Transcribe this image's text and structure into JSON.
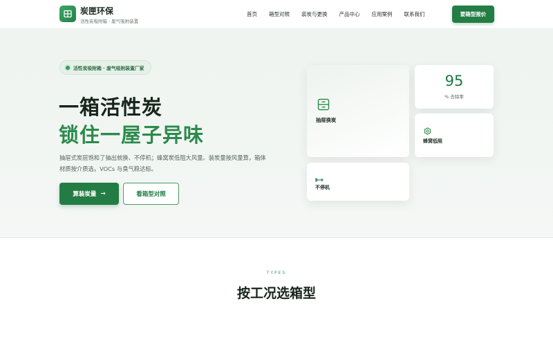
{
  "brand": {
    "name": "炭匣环保",
    "tagline": "活性炭吸附箱 · 废气吸附装置"
  },
  "nav": {
    "items": [
      {
        "label": "首页"
      },
      {
        "label": "箱型对照"
      },
      {
        "label": "装炭与更换"
      },
      {
        "label": "产品中心"
      },
      {
        "label": "应用案例"
      },
      {
        "label": "联系我们"
      }
    ],
    "cta_label": "要箱型报价"
  },
  "hero": {
    "badge": "活性炭吸附箱 · 废气吸附装置厂家",
    "title_line1": "一箱活性炭",
    "title_line2": "锁住一屋子异味",
    "description": "抽屉式炭层饱和了抽出就换、不停机；蜂窝炭低阻大风量。装炭量按风量算，箱体材质按介质选，VOCs 与臭气稳达标。",
    "primary_button": "算装炭量",
    "primary_arrow": "→",
    "secondary_button": "看箱型对照"
  },
  "cards": {
    "drawer": {
      "label": "抽屉换炭",
      "icon": "drawer-icon"
    },
    "stat": {
      "value": "95",
      "label": "% 去除率"
    },
    "honeycomb": {
      "label": "蜂窝低阻",
      "icon": "honeycomb-icon"
    },
    "nonstop": {
      "label": "不停机",
      "icon": "swap-arrows-icon"
    }
  },
  "types_section": {
    "eyebrow": "TYPES",
    "title": "按工况选箱型"
  },
  "colors": {
    "brand_green": "#247c45",
    "accent_green": "#2c8a4d",
    "hero_bg": "#eff4f0"
  }
}
